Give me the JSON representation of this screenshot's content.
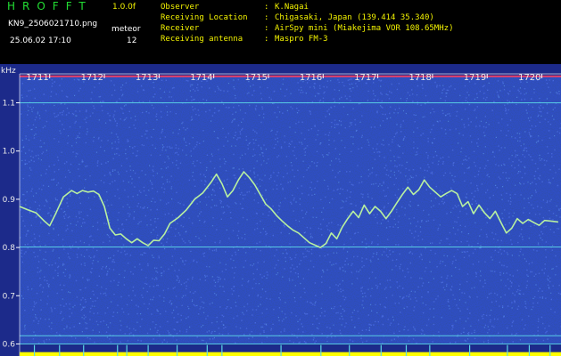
{
  "header": {
    "app_title": "HROFFT",
    "version": "1.0.0f",
    "filename": "KN9_2506021710.png",
    "datetime": "25.06.02 17:10",
    "meteor_label": "meteor",
    "meteor_count": "12"
  },
  "info": [
    {
      "key": "Observer",
      "value": "K.Nagai"
    },
    {
      "key": "Receiving Location",
      "value": "Chigasaki, Japan (139.414 35.340)"
    },
    {
      "key": "Receiver",
      "value": "AirSpy mini (Miakejima VOR 108.65MHz)"
    },
    {
      "key": "Receiving antenna",
      "value": "Maspro FM-3"
    }
  ],
  "info_separator": ":",
  "colors": {
    "background": "#1c2a8a",
    "header_text_green": "#22dd33",
    "header_text_yellow": "#f2f200",
    "trace": "#b8f0a0",
    "hline": "#5cd8e8",
    "baseline": "#ff4060",
    "noise_bar": "#ffff00"
  },
  "chart_data": {
    "type": "line",
    "title": "",
    "xlabel": "",
    "ylabel": "kHz",
    "x_ticks": [
      "1711",
      "1712",
      "1713",
      "1714",
      "1715",
      "1716",
      "1717",
      "1718",
      "1719",
      "1720"
    ],
    "y_ticks": [
      "1.1",
      "1.0",
      "0.9",
      "0.8",
      "0.7",
      "0.6"
    ],
    "y_tick_values": [
      1.1,
      1.0,
      0.9,
      0.8,
      0.7,
      0.6
    ],
    "ylim": [
      0.575,
      1.16
    ],
    "xlim": [
      1710.45,
      1720.35
    ],
    "horizontal_lines": [
      1.155,
      1.1,
      0.801,
      0.617,
      0.6
    ],
    "series": [
      {
        "x": [
          1710.45,
          1710.6,
          1710.75,
          1710.9,
          1711.0,
          1711.1,
          1711.25,
          1711.4,
          1711.5,
          1711.6,
          1711.7,
          1711.8,
          1711.9,
          1712.0,
          1712.1,
          1712.2,
          1712.3,
          1712.4,
          1712.5,
          1712.6,
          1712.7,
          1712.8,
          1712.9,
          1713.0,
          1713.1,
          1713.2,
          1713.35,
          1713.5,
          1713.65,
          1713.8,
          1713.95,
          1714.05,
          1714.15,
          1714.25,
          1714.35,
          1714.45,
          1714.55,
          1714.65,
          1714.75,
          1714.85,
          1714.95,
          1715.05,
          1715.15,
          1715.25,
          1715.35,
          1715.45,
          1715.55,
          1715.65,
          1715.75,
          1715.85,
          1715.95,
          1716.05,
          1716.15,
          1716.25,
          1716.35,
          1716.45,
          1716.55,
          1716.65,
          1716.75,
          1716.85,
          1716.95,
          1717.05,
          1717.15,
          1717.25,
          1717.35,
          1717.45,
          1717.55,
          1717.65,
          1717.75,
          1717.85,
          1717.95,
          1718.05,
          1718.15,
          1718.25,
          1718.35,
          1718.45,
          1718.55,
          1718.65,
          1718.75,
          1718.85,
          1718.95,
          1719.05,
          1719.15,
          1719.25,
          1719.35,
          1719.45,
          1719.55,
          1719.65,
          1719.75,
          1719.85,
          1719.95,
          1720.05,
          1720.15,
          1720.3
        ],
        "y": [
          0.885,
          0.878,
          0.872,
          0.855,
          0.845,
          0.868,
          0.905,
          0.918,
          0.912,
          0.918,
          0.915,
          0.917,
          0.91,
          0.885,
          0.84,
          0.826,
          0.828,
          0.818,
          0.81,
          0.818,
          0.81,
          0.804,
          0.815,
          0.814,
          0.828,
          0.85,
          0.862,
          0.878,
          0.9,
          0.913,
          0.935,
          0.952,
          0.932,
          0.905,
          0.918,
          0.94,
          0.957,
          0.945,
          0.93,
          0.91,
          0.89,
          0.88,
          0.866,
          0.855,
          0.845,
          0.836,
          0.83,
          0.82,
          0.81,
          0.805,
          0.8,
          0.808,
          0.83,
          0.818,
          0.842,
          0.86,
          0.875,
          0.862,
          0.888,
          0.87,
          0.885,
          0.875,
          0.86,
          0.875,
          0.893,
          0.91,
          0.925,
          0.91,
          0.92,
          0.94,
          0.925,
          0.915,
          0.905,
          0.912,
          0.918,
          0.912,
          0.885,
          0.895,
          0.87,
          0.888,
          0.872,
          0.86,
          0.875,
          0.852,
          0.83,
          0.84,
          0.86,
          0.85,
          0.858,
          0.852,
          0.846,
          0.856,
          0.855,
          0.853
        ]
      }
    ],
    "noise_floor_kHz": 0.583,
    "noise_spikes_x": [
      1710.72,
      1711.18,
      1711.62,
      1712.24,
      1712.41,
      1712.8,
      1713.33,
      1713.88,
      1714.15,
      1715.23,
      1715.96,
      1716.48,
      1717.06,
      1717.52,
      1717.95,
      1718.68,
      1719.37,
      1719.77,
      1720.15
    ],
    "grid": false,
    "legend": "none"
  }
}
